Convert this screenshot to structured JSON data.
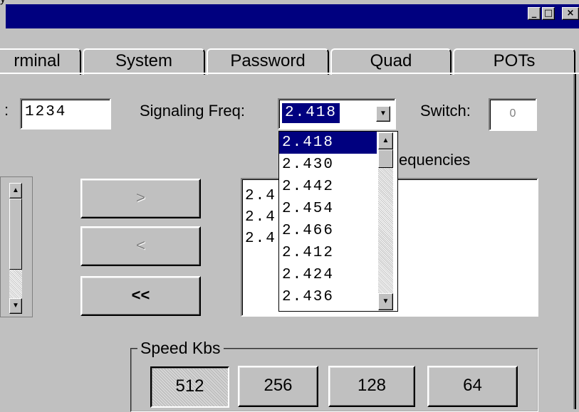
{
  "window": {
    "title_fragment": "y",
    "minimize_glyph": "_",
    "maximize_glyph": "□",
    "close_glyph": "×"
  },
  "tabs": [
    {
      "label": "rminal"
    },
    {
      "label": "System"
    },
    {
      "label": "Password"
    },
    {
      "label": "Quad"
    },
    {
      "label": "POTs"
    }
  ],
  "fields": {
    "left_label_fragment": ":",
    "left_value": "1234",
    "signaling_freq_label": "Signaling Freq:",
    "signaling_freq_value": "2.418",
    "switch_label": "Switch:",
    "switch_value": "0"
  },
  "dropdown": {
    "options": [
      "2.418",
      "2.430",
      "2.442",
      "2.454",
      "2.466",
      "2.412",
      "2.424",
      "2.436"
    ],
    "selected": "2.418"
  },
  "frequencies": {
    "label_fragment": "equencies",
    "list_items": [
      "2.4",
      "2.4",
      "2.4"
    ]
  },
  "move_buttons": {
    "add": ">",
    "remove": "<",
    "remove_all": "<<"
  },
  "speed": {
    "legend": "Speed Kbs",
    "options": [
      "512",
      "256",
      "128",
      "64"
    ],
    "selected": "512"
  },
  "colors": {
    "face": "#c0c0c0",
    "titlebar": "#00007f",
    "selection": "#00007f"
  }
}
